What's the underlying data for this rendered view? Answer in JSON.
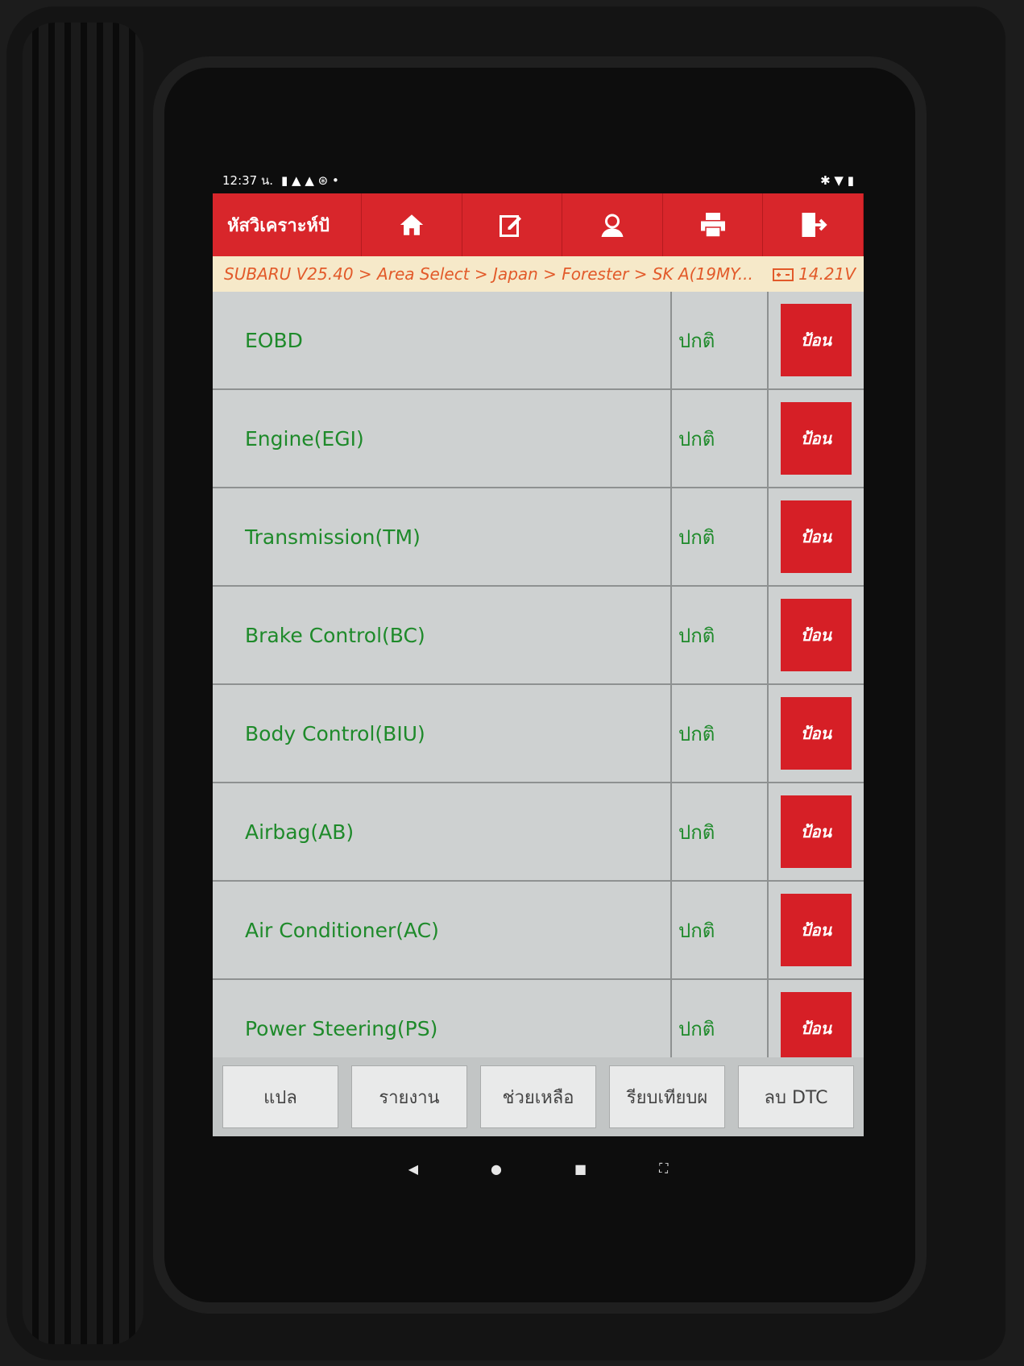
{
  "statusbar": {
    "time": "12:37 น.",
    "icons_left": "▮ ▲ ▲ ⊛ •",
    "icons_right": "✱ ▼ ▮"
  },
  "toolbar": {
    "title": "หัสวิเคราะห์ปั",
    "buttons": [
      {
        "icon": "home-icon"
      },
      {
        "icon": "edit-icon"
      },
      {
        "icon": "user-support-icon"
      },
      {
        "icon": "printer-icon"
      },
      {
        "icon": "exit-icon"
      }
    ]
  },
  "breadcrumb": {
    "path": "SUBARU V25.40 > Area Select > Japan > Forester > SK A(19MY...",
    "voltage": "14.21V"
  },
  "rows": [
    {
      "name": "EOBD",
      "status": "ปกติ",
      "action": "ป้อน"
    },
    {
      "name": "Engine(EGI)",
      "status": "ปกติ",
      "action": "ป้อน"
    },
    {
      "name": "Transmission(TM)",
      "status": "ปกติ",
      "action": "ป้อน"
    },
    {
      "name": "Brake Control(BC)",
      "status": "ปกติ",
      "action": "ป้อน"
    },
    {
      "name": "Body Control(BIU)",
      "status": "ปกติ",
      "action": "ป้อน"
    },
    {
      "name": "Airbag(AB)",
      "status": "ปกติ",
      "action": "ป้อน"
    },
    {
      "name": "Air Conditioner(AC)",
      "status": "ปกติ",
      "action": "ป้อน"
    },
    {
      "name": "Power Steering(PS)",
      "status": "ปกติ",
      "action": "ป้อน"
    }
  ],
  "bottom_buttons": [
    "แปล",
    "รายงาน",
    "ช่วยเหลือ",
    "รียบเทียบผ",
    "ลบ DTC"
  ],
  "navbar": [
    "◀",
    "●",
    "■",
    "⛶"
  ],
  "colors": {
    "toolbar": "#d8262b",
    "text_green": "#1e8a2a",
    "breadcrumb_bg": "#f6e9c9",
    "breadcrumb_text": "#e25a2a"
  }
}
